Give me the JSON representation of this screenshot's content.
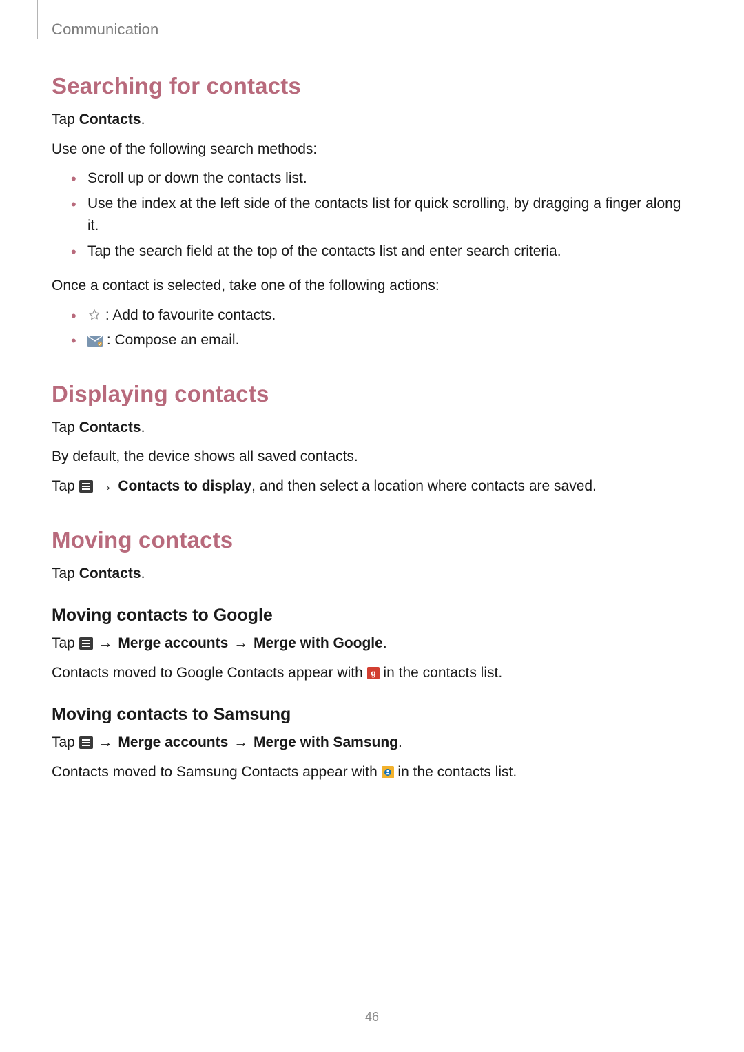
{
  "runningHead": "Communication",
  "pageNumber": "46",
  "arrow": "→",
  "sections": {
    "s1": {
      "title": "Searching for contacts",
      "tapPrefix": "Tap ",
      "tapBold": "Contacts",
      "tapSuffix": ".",
      "intro": "Use one of the following search methods:",
      "bullets": [
        "Scroll up or down the contacts list.",
        "Use the index at the left side of the contacts list for quick scrolling, by dragging a finger along it.",
        "Tap the search field at the top of the contacts list and enter search criteria."
      ],
      "after1": "Once a contact is selected, take one of the following actions:",
      "iconBullets": [
        " : Add to favourite contacts.",
        " : Compose an email."
      ]
    },
    "s2": {
      "title": "Displaying contacts",
      "tapPrefix": "Tap ",
      "tapBold": "Contacts",
      "tapSuffix": ".",
      "line2": "By default, the device shows all saved contacts.",
      "line3a": "Tap ",
      "line3bBold": "Contacts to display",
      "line3c": ", and then select a location where contacts are saved."
    },
    "s3": {
      "title": "Moving contacts",
      "tapPrefix": "Tap ",
      "tapBold": "Contacts",
      "tapSuffix": ".",
      "sub1": {
        "title": "Moving contacts to Google",
        "lineA_pre": "Tap ",
        "lineA_b1": "Merge accounts",
        "lineA_b2": "Merge with Google",
        "lineA_suffix": ".",
        "lineB_pre": "Contacts moved to Google Contacts appear with ",
        "lineB_post": " in the contacts list."
      },
      "sub2": {
        "title": "Moving contacts to Samsung",
        "lineA_pre": "Tap ",
        "lineA_b1": "Merge accounts",
        "lineA_b2": "Merge with Samsung",
        "lineA_suffix": ".",
        "lineB_pre": "Contacts moved to Samsung Contacts appear with ",
        "lineB_post": " in the contacts list."
      }
    }
  }
}
